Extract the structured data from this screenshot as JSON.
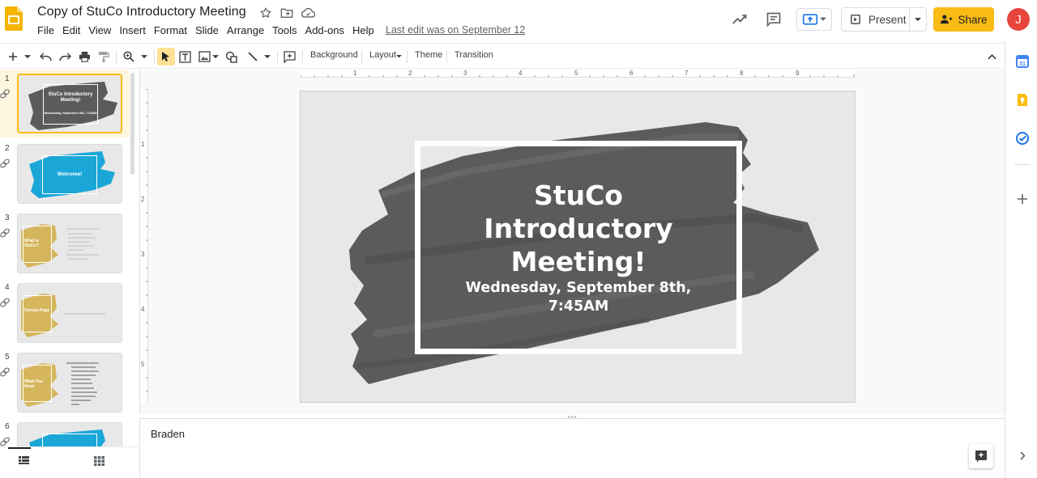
{
  "document": {
    "title": "Copy of StuCo Introductory Meeting",
    "last_edit": "Last edit was on September 12"
  },
  "menu": [
    "File",
    "Edit",
    "View",
    "Insert",
    "Format",
    "Slide",
    "Arrange",
    "Tools",
    "Add-ons",
    "Help"
  ],
  "header": {
    "present_label": "Present",
    "share_label": "Share",
    "avatar_initial": "J"
  },
  "toolbar": {
    "background_label": "Background",
    "layout_label": "Layout",
    "theme_label": "Theme",
    "transition_label": "Transition"
  },
  "filmstrip": {
    "slides": [
      {
        "number": "1",
        "title": "StuCo Introductory Meeting!",
        "subtitle": "Wednesday, September 8th, 7:45AM"
      },
      {
        "number": "2",
        "title": "Welcome!"
      },
      {
        "number": "3",
        "title": "What is StuCo?"
      },
      {
        "number": "4",
        "title": "Canvas Page"
      },
      {
        "number": "5",
        "title": "What You Need"
      },
      {
        "number": "6",
        "title": ""
      }
    ]
  },
  "slide": {
    "title": "StuCo\nIntroductory\nMeeting!",
    "subtitle": "Wednesday, September 8th,\n7:45AM"
  },
  "ruler": {
    "h_marks": [
      "1",
      "2",
      "3",
      "4",
      "5",
      "6",
      "7",
      "8",
      "9"
    ],
    "v_marks": [
      "1",
      "2",
      "3",
      "4",
      "5"
    ]
  },
  "notes": {
    "text": "Braden"
  },
  "colors": {
    "accent_yellow": "#f9bc15",
    "avatar_red": "#e8453c",
    "thumb_blue": "#1aa7d8",
    "thumb_gold": "#d6b65c",
    "brush_gray": "#5b5b5b"
  }
}
